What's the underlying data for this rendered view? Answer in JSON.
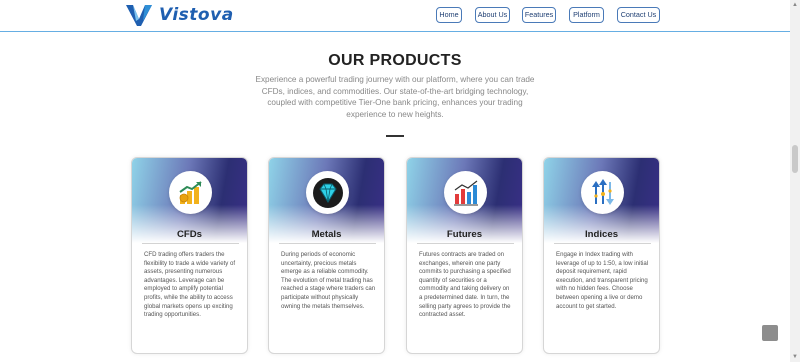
{
  "brand": {
    "name": "Vistova"
  },
  "nav": {
    "home": "Home",
    "about": "About Us",
    "features": "Features",
    "platform": "Platform",
    "contact": "Contact Us"
  },
  "products": {
    "title": "OUR PRODUCTS",
    "intro": "Experience a powerful trading journey with our platform, where you can trade CFDs, indices, and commodities. Our state-of-the-art bridging technology, coupled with competitive Tier-One bank pricing, enhances your trading experience to new heights.",
    "cards": [
      {
        "title": "CFDs",
        "icon": "cfd-chart-icon",
        "text": "CFD trading offers traders the flexibility to trade a wide variety of assets, presenting numerous advantages. Leverage can be employed to amplify potential profits, while the ability to access global markets opens up exciting trading opportunities."
      },
      {
        "title": "Metals",
        "icon": "diamond-icon",
        "text": "During periods of economic uncertainty, precious metals emerge as a reliable commodity. The evolution of metal trading has reached a stage where traders can participate without physically owning the metals themselves."
      },
      {
        "title": "Futures",
        "icon": "bar-chart-icon",
        "text": "Futures contracts are traded on exchanges, wherein one party commits to purchasing a specified quantity of securities or a commodity and taking delivery on a predetermined date. In turn, the selling party agrees to provide the contracted asset."
      },
      {
        "title": "Indices",
        "icon": "index-arrows-icon",
        "text": "Engage in Index trading with leverage of up to 1:50, a low initial deposit requirement, rapid execution, and transparent pricing with no hidden fees. Choose between opening a live or demo account to get started."
      }
    ]
  },
  "colors": {
    "brand": "#1f5fb0",
    "nav_border": "#4a7ab8",
    "card_gradient_dark": "#2c2f73",
    "card_gradient_light": "#8fd3e8"
  },
  "icons": {
    "back_to_top": "back-to-top-button"
  }
}
